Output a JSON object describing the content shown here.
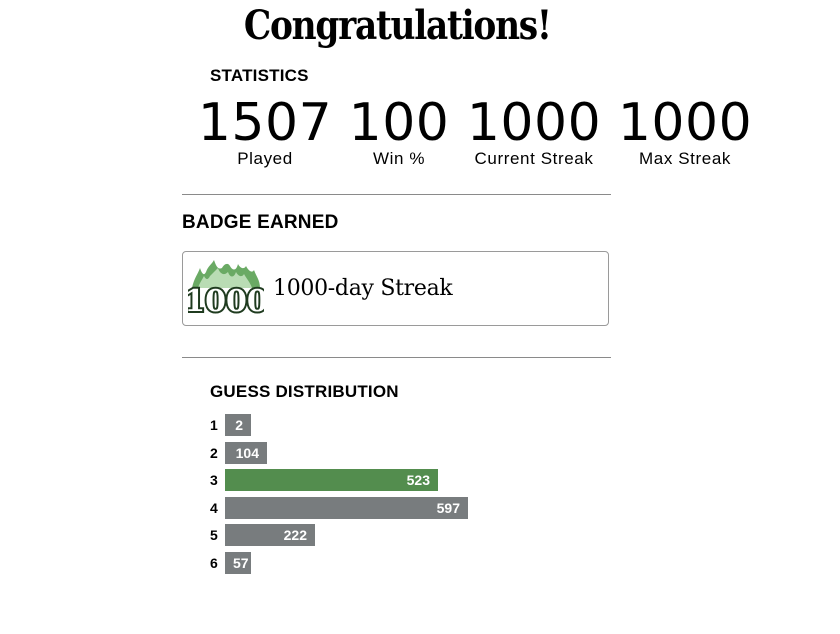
{
  "title": "Congratulations!",
  "statistics": {
    "label": "STATISTICS",
    "items": [
      {
        "value": "1507",
        "label": "Played"
      },
      {
        "value": "100",
        "label": "Win %"
      },
      {
        "value": "1000",
        "label": "Current Streak"
      },
      {
        "value": "1000",
        "label": "Max Streak"
      }
    ]
  },
  "badge": {
    "label": "BADGE EARNED",
    "icon_text": "1000",
    "icon": "flame-streak-badge-icon",
    "name": "1000-day Streak"
  },
  "distribution": {
    "label": "GUESS DISTRIBUTION",
    "rows": [
      {
        "guess": "1",
        "count": "2"
      },
      {
        "guess": "2",
        "count": "104"
      },
      {
        "guess": "3",
        "count": "523"
      },
      {
        "guess": "4",
        "count": "597"
      },
      {
        "guess": "5",
        "count": "222"
      },
      {
        "guess": "6",
        "count": "57"
      }
    ],
    "highlight_row": 2
  },
  "colors": {
    "bar": "#787c7e",
    "highlight": "#538d4e",
    "badge_green": "#6aaa64"
  }
}
